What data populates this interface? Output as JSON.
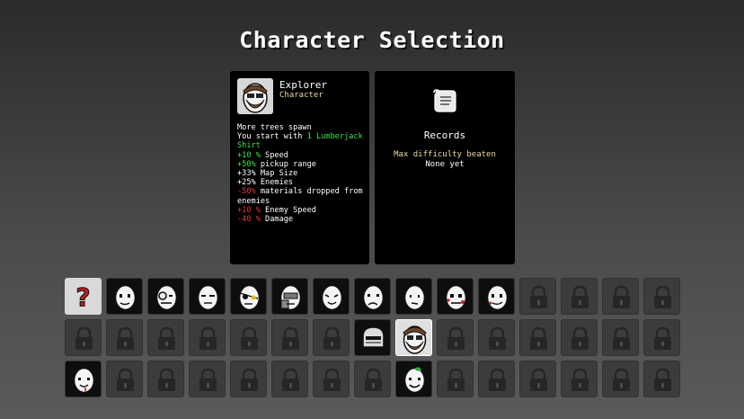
{
  "screen": {
    "title": "Character Selection"
  },
  "character": {
    "name": "Explorer",
    "type": "Character",
    "portrait_icon": "explorer-portrait-icon",
    "description": [
      {
        "parts": [
          {
            "t": "More trees spawn",
            "c": "w"
          }
        ]
      },
      {
        "parts": [
          {
            "t": "You start with ",
            "c": "w"
          },
          {
            "t": "1 Lumberjack Shirt",
            "c": "g"
          }
        ]
      },
      {
        "parts": [
          {
            "t": "+10 %",
            "c": "g"
          },
          {
            "t": " Speed",
            "c": "w"
          }
        ]
      },
      {
        "parts": [
          {
            "t": "+50%",
            "c": "g"
          },
          {
            "t": " pickup range",
            "c": "w"
          }
        ]
      },
      {
        "parts": [
          {
            "t": "+33% Map Size",
            "c": "w"
          }
        ]
      },
      {
        "parts": [
          {
            "t": "+25% Enemies",
            "c": "w"
          }
        ]
      },
      {
        "parts": [
          {
            "t": "-50%",
            "c": "r"
          },
          {
            "t": " materials dropped from enemies",
            "c": "w"
          }
        ]
      },
      {
        "parts": [
          {
            "t": "+10 %",
            "c": "r"
          },
          {
            "t": " Enemy Speed",
            "c": "w"
          }
        ]
      },
      {
        "parts": [
          {
            "t": "-40 %",
            "c": "r"
          },
          {
            "t": " Damage",
            "c": "w"
          }
        ]
      }
    ]
  },
  "records": {
    "icon": "scroll-icon",
    "title": "Records",
    "subtitle": "Max difficulty beaten",
    "value": "None yet"
  },
  "colors": {
    "positive": "#3fe24a",
    "negative": "#e23a3a",
    "accent": "#e8d9a5"
  },
  "slots": [
    {
      "row": 0,
      "col": 0,
      "kind": "random",
      "icon": "question-mark-icon"
    },
    {
      "row": 0,
      "col": 1,
      "kind": "unlocked",
      "icon": "egg-face-plain-icon"
    },
    {
      "row": 0,
      "col": 2,
      "kind": "unlocked",
      "icon": "egg-face-monocle-icon"
    },
    {
      "row": 0,
      "col": 3,
      "kind": "unlocked",
      "icon": "egg-face-squint-icon"
    },
    {
      "row": 0,
      "col": 4,
      "kind": "unlocked",
      "icon": "egg-face-eyepatch-icon"
    },
    {
      "row": 0,
      "col": 5,
      "kind": "unlocked",
      "icon": "egg-face-knight-icon"
    },
    {
      "row": 0,
      "col": 6,
      "kind": "unlocked",
      "icon": "egg-face-tongue-icon"
    },
    {
      "row": 0,
      "col": 7,
      "kind": "unlocked",
      "icon": "egg-face-frown-icon"
    },
    {
      "row": 0,
      "col": 8,
      "kind": "unlocked",
      "icon": "egg-face-grin-icon"
    },
    {
      "row": 0,
      "col": 9,
      "kind": "unlocked",
      "icon": "egg-face-bloody-icon"
    },
    {
      "row": 0,
      "col": 10,
      "kind": "unlocked",
      "icon": "egg-face-smirk-icon"
    },
    {
      "row": 0,
      "col": 11,
      "kind": "locked",
      "icon": "padlock-icon"
    },
    {
      "row": 0,
      "col": 12,
      "kind": "locked",
      "icon": "padlock-icon"
    },
    {
      "row": 0,
      "col": 13,
      "kind": "locked",
      "icon": "padlock-icon"
    },
    {
      "row": 0,
      "col": 14,
      "kind": "locked",
      "icon": "padlock-icon"
    },
    {
      "row": 1,
      "col": 0,
      "kind": "locked",
      "icon": "padlock-icon"
    },
    {
      "row": 1,
      "col": 1,
      "kind": "locked",
      "icon": "padlock-icon"
    },
    {
      "row": 1,
      "col": 2,
      "kind": "locked",
      "icon": "padlock-icon"
    },
    {
      "row": 1,
      "col": 3,
      "kind": "locked",
      "icon": "padlock-icon"
    },
    {
      "row": 1,
      "col": 4,
      "kind": "locked",
      "icon": "padlock-icon"
    },
    {
      "row": 1,
      "col": 5,
      "kind": "locked",
      "icon": "padlock-icon"
    },
    {
      "row": 1,
      "col": 6,
      "kind": "locked",
      "icon": "padlock-icon"
    },
    {
      "row": 1,
      "col": 7,
      "kind": "unlocked",
      "icon": "knight-helmet-icon"
    },
    {
      "row": 1,
      "col": 8,
      "kind": "selected",
      "icon": "explorer-portrait-icon"
    },
    {
      "row": 1,
      "col": 9,
      "kind": "locked",
      "icon": "padlock-icon"
    },
    {
      "row": 1,
      "col": 10,
      "kind": "locked",
      "icon": "padlock-icon"
    },
    {
      "row": 1,
      "col": 11,
      "kind": "locked",
      "icon": "padlock-icon"
    },
    {
      "row": 1,
      "col": 12,
      "kind": "locked",
      "icon": "padlock-icon"
    },
    {
      "row": 1,
      "col": 13,
      "kind": "locked",
      "icon": "padlock-icon"
    },
    {
      "row": 1,
      "col": 14,
      "kind": "locked",
      "icon": "padlock-icon"
    },
    {
      "row": 2,
      "col": 0,
      "kind": "unlocked",
      "icon": "egg-face-drool-icon"
    },
    {
      "row": 2,
      "col": 1,
      "kind": "locked",
      "icon": "padlock-icon"
    },
    {
      "row": 2,
      "col": 2,
      "kind": "locked",
      "icon": "padlock-icon"
    },
    {
      "row": 2,
      "col": 3,
      "kind": "locked",
      "icon": "padlock-icon"
    },
    {
      "row": 2,
      "col": 4,
      "kind": "locked",
      "icon": "padlock-icon"
    },
    {
      "row": 2,
      "col": 5,
      "kind": "locked",
      "icon": "padlock-icon"
    },
    {
      "row": 2,
      "col": 6,
      "kind": "locked",
      "icon": "padlock-icon"
    },
    {
      "row": 2,
      "col": 7,
      "kind": "locked",
      "icon": "padlock-icon"
    },
    {
      "row": 2,
      "col": 8,
      "kind": "unlocked",
      "icon": "egg-face-leaf-icon"
    },
    {
      "row": 2,
      "col": 9,
      "kind": "locked",
      "icon": "padlock-icon"
    },
    {
      "row": 2,
      "col": 10,
      "kind": "locked",
      "icon": "padlock-icon"
    },
    {
      "row": 2,
      "col": 11,
      "kind": "locked",
      "icon": "padlock-icon"
    },
    {
      "row": 2,
      "col": 12,
      "kind": "locked",
      "icon": "padlock-icon"
    },
    {
      "row": 2,
      "col": 13,
      "kind": "locked",
      "icon": "padlock-icon"
    },
    {
      "row": 2,
      "col": 14,
      "kind": "locked",
      "icon": "padlock-icon"
    }
  ]
}
